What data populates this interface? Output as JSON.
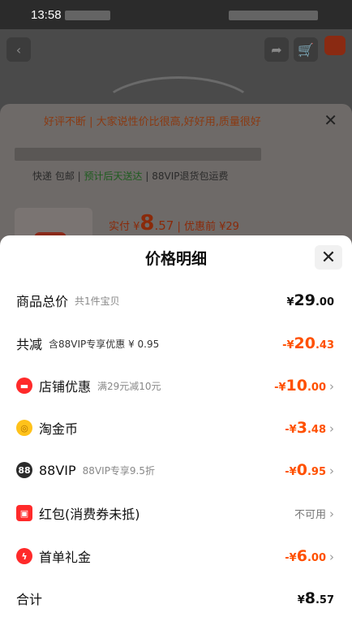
{
  "status_bar": {
    "time": "13:58"
  },
  "bg": {
    "banner": "好评不断 | 大家说性价比很高,好好用,质量很好",
    "shipping": {
      "express": "快递 包邮",
      "eta": "预计后天送达",
      "vip": "88VIP退货包运费"
    },
    "paid": {
      "prefix": "实付 ¥",
      "int": "8",
      "dec": ".57",
      "before": "| 优惠前 ¥29"
    }
  },
  "sheet": {
    "title": "价格明细",
    "rows": [
      {
        "label": "商品总价",
        "sub": "共1件宝贝",
        "yen": "¥",
        "int": "29",
        "dec": ".00"
      },
      {
        "label": "共减",
        "sub": "含88VIP专享优惠 ¥ 0.95",
        "yen": "-¥",
        "int": "20",
        "dec": ".43"
      },
      {
        "label": "店铺优惠",
        "sub": "满29元减10元",
        "yen": "-¥",
        "int": "10",
        "dec": ".00",
        "icon": "store-coupon-icon",
        "color": "#ff2a2a"
      },
      {
        "label": "淘金币",
        "sub": "",
        "yen": "-¥",
        "int": "3",
        "dec": ".48",
        "icon": "gold-coin-icon",
        "color": "#ffc21a"
      },
      {
        "label": "88VIP",
        "sub": "88VIP专享9.5折",
        "yen": "-¥",
        "int": "0",
        "dec": ".95",
        "icon": "88vip-icon",
        "color": "#2b2b2b",
        "icon_text": "88"
      },
      {
        "label": "红包(消费券未抵)",
        "sub": "",
        "status": "不可用",
        "icon": "red-envelope-icon",
        "color": "#ff2a2a"
      },
      {
        "label": "首单礼金",
        "sub": "",
        "yen": "-¥",
        "int": "6",
        "dec": ".00",
        "icon": "lightning-icon",
        "color": "#ff2a2a"
      },
      {
        "label": "合计",
        "sub": "",
        "yen": "¥",
        "int": "8",
        "dec": ".57"
      }
    ]
  }
}
